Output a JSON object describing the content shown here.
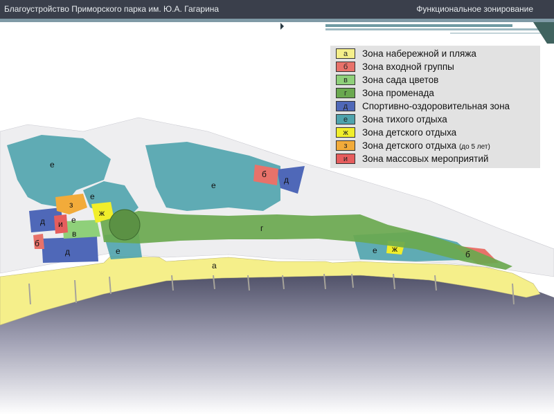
{
  "header": {
    "title": "Благоустройство Приморского парка им. Ю.А. Гагарина",
    "section": "Функциональное зонирование"
  },
  "legend": {
    "items": [
      {
        "letter": "а",
        "label": "Зона набережной и пляжа",
        "color": "#f5ef8a"
      },
      {
        "letter": "б",
        "label": "Зона входной группы",
        "color": "#e8726a"
      },
      {
        "letter": "в",
        "label": "Зона сада цветов",
        "color": "#8fd07a"
      },
      {
        "letter": "г",
        "label": "Зона променада",
        "color": "#6aa84f"
      },
      {
        "letter": "д",
        "label": "Спортивно-оздоровительная зона",
        "color": "#4f68b8"
      },
      {
        "letter": "е",
        "label": "Зона тихого отдыха",
        "color": "#4fa3ad"
      },
      {
        "letter": "ж",
        "label": "Зона детского отдыха",
        "color": "#f1ee2a"
      },
      {
        "letter": "з",
        "label": "Зона детского отдыха",
        "note": "(до 5 лет)",
        "color": "#f2ab3a"
      },
      {
        "letter": "и",
        "label": "Зона массовых мероприятий",
        "color": "#e65d5d"
      }
    ]
  },
  "map_labels": {
    "e1": "е",
    "e2": "е",
    "e3": "е",
    "e4": "е",
    "e5": "е",
    "e6": "е",
    "b1": "б",
    "b2": "б",
    "b3": "б",
    "d1": "д",
    "d2": "д",
    "d3": "д",
    "z1": "з",
    "zh1": "ж",
    "zh2": "ж",
    "i1": "и",
    "v1": "в",
    "g1": "г",
    "a1": "а"
  }
}
